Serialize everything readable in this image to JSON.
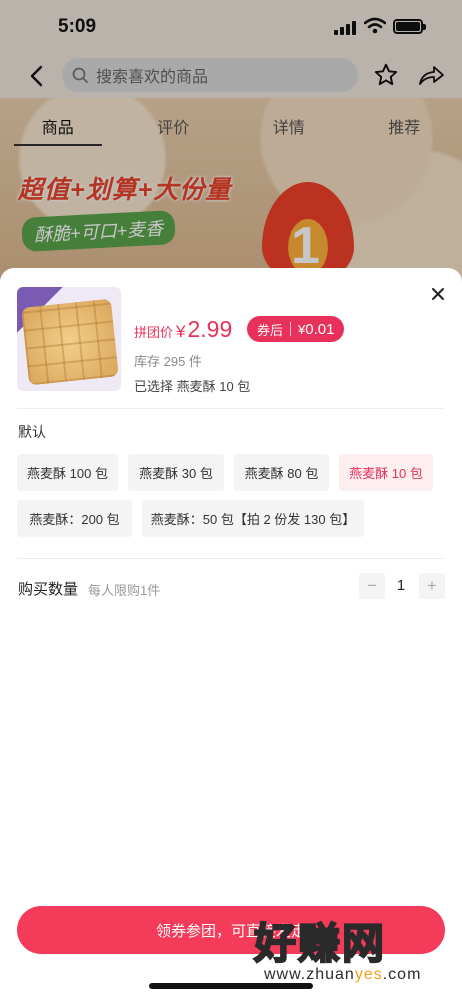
{
  "status_bar": {
    "time": "5:09"
  },
  "nav": {
    "search_placeholder": "搜索喜欢的商品"
  },
  "tabs": [
    {
      "label": "商品",
      "active": true
    },
    {
      "label": "评价",
      "active": false
    },
    {
      "label": "详情",
      "active": false
    },
    {
      "label": "推荐",
      "active": false
    }
  ],
  "hero": {
    "promo_line1": "超值+划算+大份量",
    "promo_line2": "酥脆+可口+麦香",
    "flame_text": "1"
  },
  "sheet": {
    "price_label": "拼团价",
    "price_symbol": "¥",
    "price_value": "2.99",
    "coupon_label": "券后",
    "coupon_symbol": "¥",
    "coupon_value": "0.01",
    "stock": "库存 295 件",
    "selected": "已选择 燕麦酥 10 包",
    "spec_title": "默认",
    "specs": [
      {
        "label": "燕麦酥 100 包",
        "active": false
      },
      {
        "label": "燕麦酥 30 包",
        "active": false
      },
      {
        "label": "燕麦酥 80 包",
        "active": false
      },
      {
        "label": "燕麦酥 10 包",
        "active": true
      },
      {
        "label": "燕麦酥：200 包",
        "active": false
      },
      {
        "label": "燕麦酥：50 包【拍 2 份发 130 包】",
        "active": false
      }
    ],
    "qty_label": "购买数量",
    "qty_limit": "每人限购1件",
    "qty_minus": "−",
    "qty_value": "1",
    "qty_plus": "+",
    "buy_button": "领券参团，可直接发走"
  },
  "watermark": {
    "big": "好赚网",
    "small_pre": "www.zhuan",
    "small_mid": "yes",
    "small_post": ".com"
  },
  "colors": {
    "accent": "#e8315a",
    "button": "#f43b5a"
  }
}
